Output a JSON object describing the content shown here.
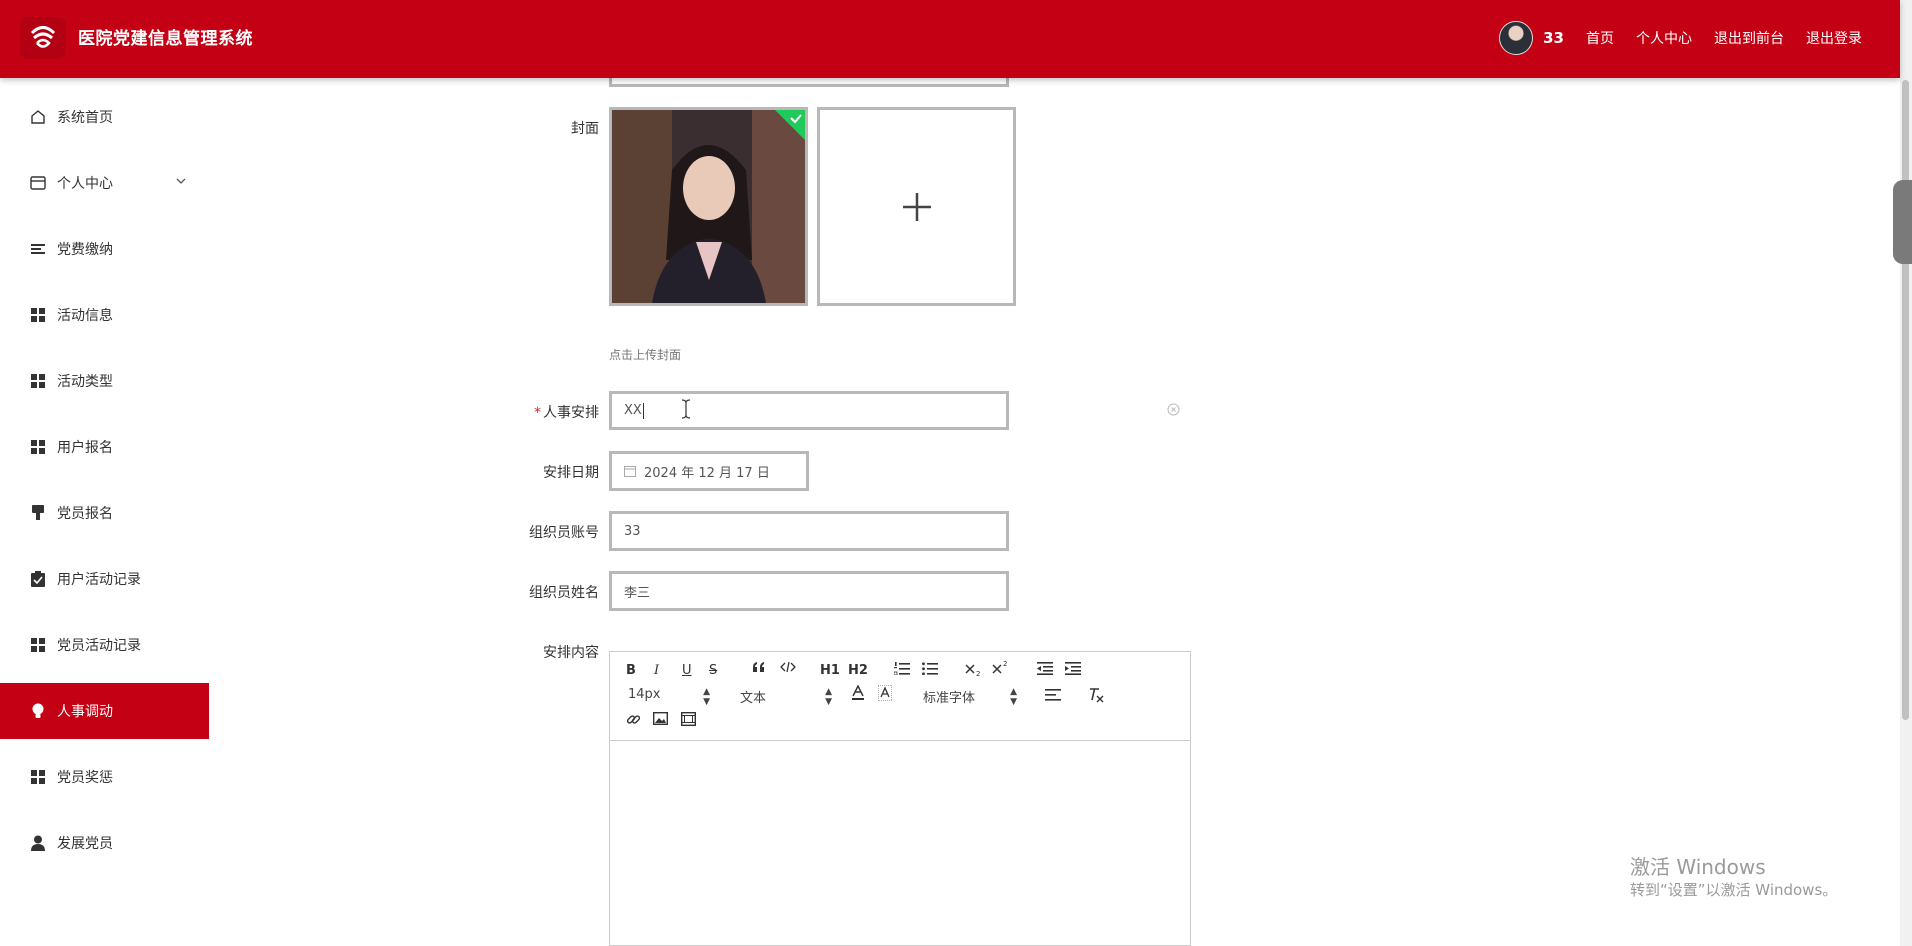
{
  "header": {
    "app_title": "医院党建信息管理系统",
    "user_name": "33",
    "nav": [
      "首页",
      "个人中心",
      "退出到前台",
      "退出登录"
    ]
  },
  "sidebar": {
    "items": [
      {
        "label": "系统首页",
        "icon": "home-icon"
      },
      {
        "label": "个人中心",
        "icon": "card-icon",
        "expandable": true
      },
      {
        "label": "党费缴纳",
        "icon": "list-icon"
      },
      {
        "label": "活动信息",
        "icon": "grid-icon"
      },
      {
        "label": "活动类型",
        "icon": "grid-icon"
      },
      {
        "label": "用户报名",
        "icon": "grid-icon"
      },
      {
        "label": "党员报名",
        "icon": "brush-icon"
      },
      {
        "label": "用户活动记录",
        "icon": "clipboard-check-icon"
      },
      {
        "label": "党员活动记录",
        "icon": "grid-icon"
      },
      {
        "label": "人事调动",
        "icon": "lightbulb-icon",
        "active": true
      },
      {
        "label": "党员奖惩",
        "icon": "grid-icon"
      },
      {
        "label": "发展党员",
        "icon": "user-icon"
      }
    ]
  },
  "form": {
    "cover_label": "封面",
    "cover_hint": "点击上传封面",
    "personnel_label": "人事安排",
    "personnel_value": "XX",
    "date_label": "安排日期",
    "date_value": "2024 年 12 月 17 日",
    "account_label": "组织员账号",
    "account_value": "33",
    "name_label": "组织员姓名",
    "name_value": "李三",
    "content_label": "安排内容"
  },
  "editor": {
    "font_size": "14px",
    "text_style": "文本",
    "font_family": "标准字体",
    "buttons": {
      "bold": "B",
      "italic": "I",
      "underline": "U",
      "strike": "S",
      "h1": "H1",
      "h2": "H2"
    }
  },
  "watermark": {
    "line1": "激活 Windows",
    "line2": "转到“设置”以激活 Windows。"
  },
  "colors": {
    "brand": "#c40015",
    "check_badge": "#1fc95a"
  }
}
